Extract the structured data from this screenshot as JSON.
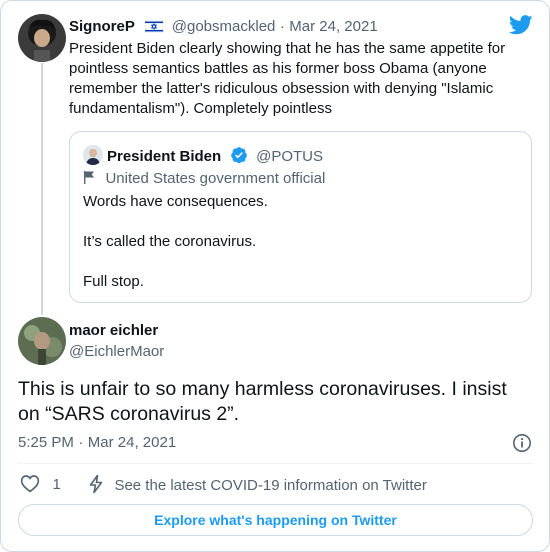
{
  "top_tweet": {
    "display_name": "SignoreP",
    "handle": "@gobsmackled",
    "separator": "·",
    "date": "Mar 24, 2021",
    "text_lines": [
      "President Biden clearly showing that he has the same appetite for",
      "pointless semantics battles as his former boss Obama (anyone",
      "remember  the latter's ridiculous obsession with denying \"Islamic",
      "fundamentalism\"). Completely pointless"
    ],
    "flag_icon": "israel-flag-icon",
    "brand_icon": "twitter-bird-icon",
    "brand_color": "#1d9bf0"
  },
  "quoted_tweet": {
    "display_name": "President Biden",
    "handle": "@POTUS",
    "label": "United States government official",
    "label_icon": "flag-icon",
    "verified_icon": "verified-badge-icon",
    "verified_color": "#1d9bf0",
    "lines": [
      "Words have consequences.",
      "It’s called the coronavirus.",
      "Full stop."
    ]
  },
  "main_tweet": {
    "display_name": "maor eichler",
    "handle": "@EichlerMaor",
    "text_lines": [
      "This is unfair to so many harmless coronaviruses. I insist",
      "on “SARS coronavirus 2”."
    ],
    "time": "5:25 PM",
    "separator": "·",
    "date": "Mar 24, 2021",
    "info_icon": "info-icon"
  },
  "actions": {
    "like_icon": "heart-icon",
    "like_count": "1",
    "covid_icon": "lightning-icon",
    "covid_text": "See the latest COVID-19 information on Twitter"
  },
  "explore_label": "Explore what's happening on Twitter",
  "colors": {
    "text": "#0f1419",
    "muted": "#536471",
    "border": "#cfd9de",
    "accent": "#1d9bf0"
  }
}
